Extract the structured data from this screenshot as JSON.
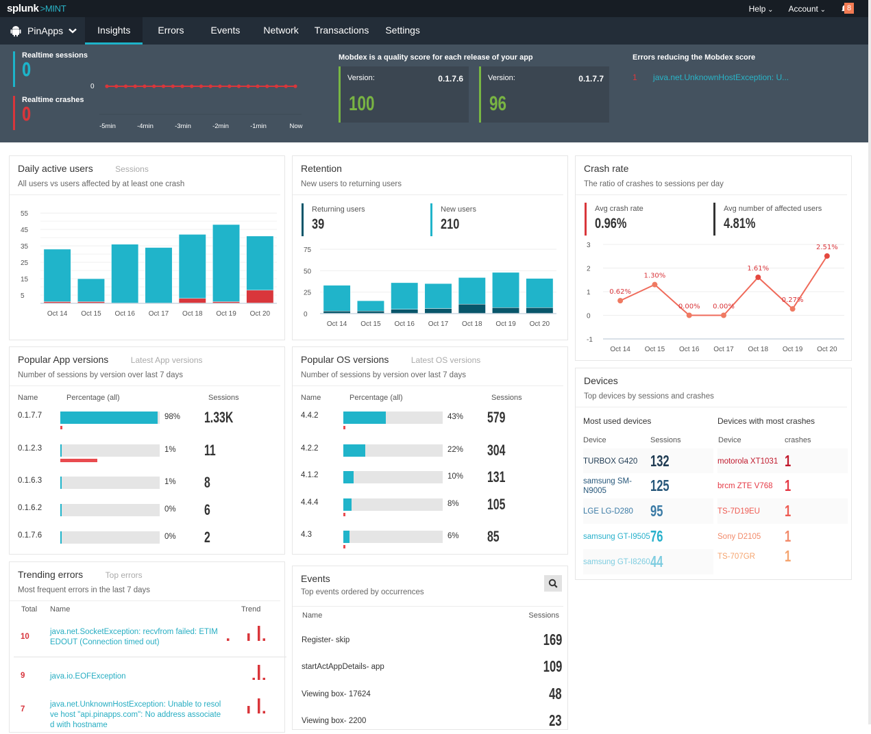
{
  "brand": {
    "name": "splunk",
    "product": ">MINT"
  },
  "topnav": {
    "help": "Help",
    "account": "Account",
    "notifications_count": "8"
  },
  "app_selector": {
    "name": "PinApps"
  },
  "tabs": [
    {
      "label": "Insights",
      "active": true
    },
    {
      "label": "Errors"
    },
    {
      "label": "Events"
    },
    {
      "label": "Network"
    },
    {
      "label": "Transactions"
    },
    {
      "label": "Settings"
    }
  ],
  "realtime": {
    "sessions_label": "Realtime sessions",
    "sessions_value": "0",
    "crashes_label": "Realtime crashes",
    "crashes_value": "0",
    "chart": {
      "y_label": "0",
      "x_ticks": [
        "-5min",
        "-4min",
        "-3min",
        "-2min",
        "-1min",
        "Now"
      ],
      "points": [
        0,
        0,
        0,
        0,
        0,
        0,
        0,
        0,
        0,
        0,
        0,
        0,
        0,
        0,
        0,
        0,
        0,
        0,
        0,
        0,
        0
      ]
    }
  },
  "mobdex": {
    "title": "Mobdex is a quality score for each release of your app",
    "cards": [
      {
        "version_label": "Version:",
        "version": "0.1.7.6",
        "score": "100"
      },
      {
        "version_label": "Version:",
        "version": "0.1.7.7",
        "score": "96"
      }
    ],
    "errors_title": "Errors reducing the Mobdex score",
    "errors": [
      {
        "count": "1",
        "name": "java.net.UnknownHostException: U..."
      }
    ]
  },
  "daily_active_users": {
    "title": "Daily active users",
    "alt_tab": "Sessions",
    "subtitle": "All users vs users affected by at least one crash"
  },
  "retention": {
    "title": "Retention",
    "subtitle": "New users to returning users",
    "returning_label": "Returning users",
    "returning_value": "39",
    "new_label": "New users",
    "new_value": "210"
  },
  "crash_rate": {
    "title": "Crash rate",
    "subtitle": "The ratio of crashes to sessions per day",
    "avg_label": "Avg crash rate",
    "avg_value": "0.96%",
    "affected_label": "Avg number of affected users",
    "affected_value": "4.81%"
  },
  "chart_data": [
    {
      "id": "daily_active_users",
      "type": "bar",
      "stacked": true,
      "categories": [
        "Oct 14",
        "Oct 15",
        "Oct 16",
        "Oct 17",
        "Oct 18",
        "Oct 19",
        "Oct 20"
      ],
      "series": [
        {
          "name": "All users",
          "color": "#20b4ca",
          "values": [
            33,
            15,
            36,
            34,
            42,
            48,
            41
          ]
        },
        {
          "name": "Users affected by crash",
          "color": "#d9363b",
          "values": [
            1,
            1,
            0,
            0,
            3,
            1,
            8
          ]
        }
      ],
      "yticks": [
        5,
        15,
        25,
        35,
        45,
        55
      ],
      "ylim": [
        0,
        58
      ],
      "grid": true
    },
    {
      "id": "retention",
      "type": "bar",
      "stacked": true,
      "categories": [
        "Oct 14",
        "Oct 15",
        "Oct 16",
        "Oct 17",
        "Oct 18",
        "Oct 19",
        "Oct 20"
      ],
      "series": [
        {
          "name": "Returning users",
          "color": "#08566a",
          "values": [
            3,
            3,
            5,
            6,
            11,
            7,
            7
          ]
        },
        {
          "name": "New users",
          "color": "#20b4ca",
          "values": [
            30,
            12,
            31,
            29,
            31,
            41,
            34
          ]
        }
      ],
      "yticks": [
        0,
        25,
        50,
        75
      ],
      "ylim": [
        0,
        75
      ],
      "grid": true
    },
    {
      "id": "crash_rate",
      "type": "line",
      "categories": [
        "Oct 14",
        "Oct 15",
        "Oct 16",
        "Oct 17",
        "Oct 18",
        "Oct 19",
        "Oct 20"
      ],
      "values": [
        0.62,
        1.3,
        0.0,
        0.0,
        1.61,
        0.27,
        2.51
      ],
      "labels": [
        "0.62%",
        "1.30%",
        "0.00%",
        "0.00%",
        "1.61%",
        "0.27%",
        "2.51%"
      ],
      "yticks": [
        -1,
        0,
        1,
        2,
        3
      ],
      "ylim": [
        -1,
        3
      ],
      "grid": true
    }
  ],
  "app_versions": {
    "title": "Popular App versions",
    "alt_tab": "Latest App versions",
    "subtitle": "Number of sessions by version over last 7 days",
    "headers": {
      "name": "Name",
      "pct": "Percentage (all)",
      "sessions": "Sessions"
    },
    "rows": [
      {
        "name": "0.1.7.7",
        "pct": "98%",
        "pct_value": 98,
        "crash_fraction": 0.02,
        "sessions": "1.33K"
      },
      {
        "name": "0.1.2.3",
        "pct": "1%",
        "pct_value": 1,
        "crash_fraction": 0.37,
        "sessions": "11"
      },
      {
        "name": "0.1.6.3",
        "pct": "1%",
        "pct_value": 1,
        "crash_fraction": 0,
        "sessions": "8"
      },
      {
        "name": "0.1.6.2",
        "pct": "0%",
        "pct_value": 1,
        "crash_fraction": 0,
        "sessions": "6"
      },
      {
        "name": "0.1.7.6",
        "pct": "0%",
        "pct_value": 1,
        "crash_fraction": 0,
        "sessions": "2"
      }
    ]
  },
  "os_versions": {
    "title": "Popular OS versions",
    "alt_tab": "Latest OS versions",
    "subtitle": "Number of sessions by version over last 7 days",
    "headers": {
      "name": "Name",
      "pct": "Percentage (all)",
      "sessions": "Sessions"
    },
    "rows": [
      {
        "name": "4.4.2",
        "pct": "43%",
        "pct_value": 43,
        "crash_fraction": 0.02,
        "sessions": "579"
      },
      {
        "name": "4.2.2",
        "pct": "22%",
        "pct_value": 22,
        "crash_fraction": 0,
        "sessions": "304"
      },
      {
        "name": "4.1.2",
        "pct": "10%",
        "pct_value": 10,
        "crash_fraction": 0,
        "sessions": "131"
      },
      {
        "name": "4.4.4",
        "pct": "8%",
        "pct_value": 8,
        "crash_fraction": 0.02,
        "sessions": "105"
      },
      {
        "name": "4.3",
        "pct": "6%",
        "pct_value": 6,
        "crash_fraction": 0.02,
        "sessions": "85"
      }
    ]
  },
  "devices": {
    "title": "Devices",
    "subtitle": "Top devices by sessions and crashes",
    "most_used_title": "Most used devices",
    "most_crashes_title": "Devices with most crashes",
    "used_headers": {
      "device": "Device",
      "sessions": "Sessions"
    },
    "crash_headers": {
      "device": "Device",
      "crashes": "crashes"
    },
    "most_used": [
      {
        "device": "TURBOX G420",
        "sessions": "132",
        "color": "#1e3a52"
      },
      {
        "device": "samsung SM-N9005",
        "sessions": "125",
        "color": "#27577a"
      },
      {
        "device": "LGE LG-D280",
        "sessions": "95",
        "color": "#3a7aa5"
      },
      {
        "device": "samsung GT-I9505",
        "sessions": "76",
        "color": "#27b0cb"
      },
      {
        "device": "samsung GT-I8260",
        "sessions": "44",
        "color": "#7fcde0"
      }
    ],
    "most_crashes": [
      {
        "device": "motorola XT1031",
        "crashes": "1",
        "color": "#c0182b"
      },
      {
        "device": "brcm ZTE V768",
        "crashes": "1",
        "color": "#e53945"
      },
      {
        "device": "TS-7D19EU",
        "crashes": "1",
        "color": "#ee5b52"
      },
      {
        "device": "Sony D2105",
        "crashes": "1",
        "color": "#f28a6a"
      },
      {
        "device": "TS-707GR",
        "crashes": "1",
        "color": "#f5a46f"
      }
    ]
  },
  "trending_errors": {
    "title": "Trending errors",
    "alt_tab": "Top errors",
    "subtitle": "Most frequent errors in the last 7 days",
    "headers": {
      "total": "Total",
      "name": "Name",
      "trend": "Trend"
    },
    "rows": [
      {
        "total": "10",
        "name": "java.net.SocketException: recvfrom failed: ETIMEDOUT (Connection timed out)",
        "trend": [
          1,
          0,
          0,
          0,
          3,
          0,
          6,
          1
        ]
      },
      {
        "total": "9",
        "name": "java.io.EOFException",
        "trend": [
          0,
          0,
          0,
          0,
          0,
          1,
          7,
          1
        ]
      },
      {
        "total": "7",
        "name": "java.net.UnknownHostException: Unable to resolve host \"api.pinapps.com\": No address associated with hostname",
        "trend": [
          0,
          0,
          0,
          0,
          3,
          0,
          6,
          1
        ]
      }
    ]
  },
  "events": {
    "title": "Events",
    "subtitle": "Top events ordered by occurrences",
    "headers": {
      "name": "Name",
      "sessions": "Sessions"
    },
    "rows": [
      {
        "name": "Register- skip",
        "sessions": "169"
      },
      {
        "name": "startActAppDetails- app",
        "sessions": "109"
      },
      {
        "name": "Viewing box- 17624",
        "sessions": "48"
      },
      {
        "name": "Viewing box- 2200",
        "sessions": "23"
      }
    ]
  }
}
